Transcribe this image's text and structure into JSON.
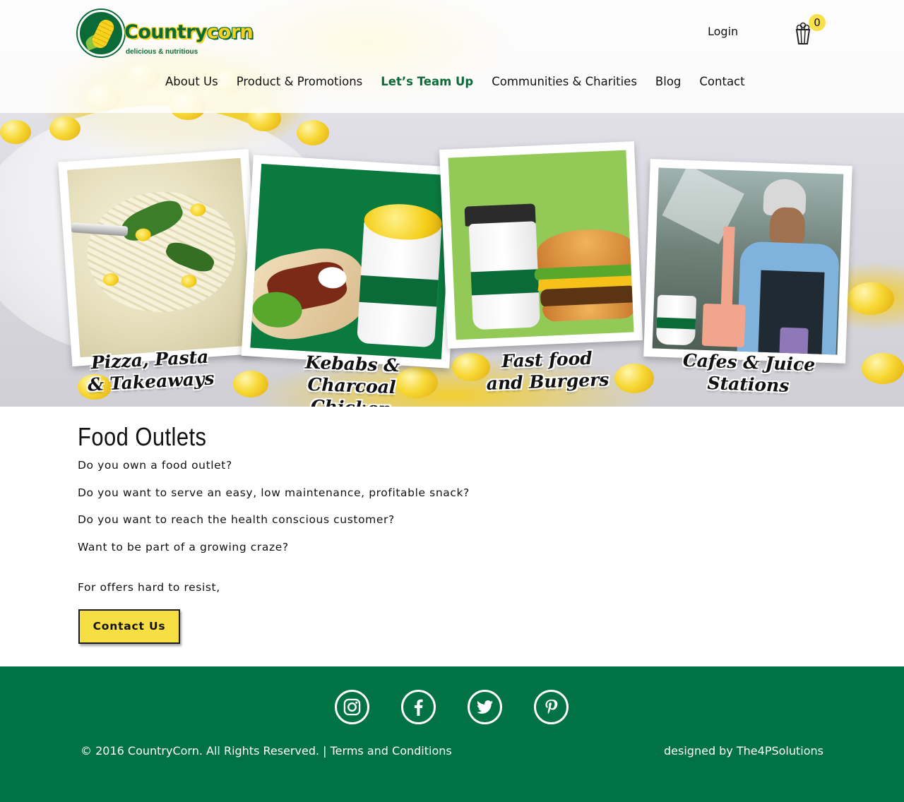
{
  "brand": {
    "name_part1": "Country",
    "name_part2": "corn",
    "tagline": "delicious & nutritious",
    "colors": {
      "green": "#0b6b38",
      "yellow": "#f5d020",
      "footer": "#007244",
      "button": "#f7de43"
    }
  },
  "header": {
    "login_label": "Login",
    "cart_icon": "popcorn-cup-icon",
    "cart_count": "0"
  },
  "nav": {
    "items": [
      {
        "label": "About Us"
      },
      {
        "label": "Product & Promotions"
      },
      {
        "label": "Let’s Team Up",
        "active": true
      },
      {
        "label": "Communities & Charities"
      },
      {
        "label": "Blog"
      },
      {
        "label": "Contact"
      }
    ]
  },
  "hero": {
    "cards": [
      {
        "caption_line1": "Pizza, Pasta",
        "caption_line2": "& Takeaways"
      },
      {
        "caption_line1": "Kebabs &",
        "caption_line2": "Charcoal Chicken"
      },
      {
        "caption_line1": "Fast food",
        "caption_line2": "and Burgers"
      },
      {
        "caption_line1": "Cafes & Juice",
        "caption_line2": "Stations"
      }
    ]
  },
  "content": {
    "title": "Food Outlets",
    "paragraphs": [
      "Do you own a food outlet?",
      "Do you want to serve an easy, low maintenance, profitable snack?",
      "Do you want to reach the health conscious customer?",
      "Want to be part of a growing craze?",
      "For offers hard to resist,"
    ],
    "button_label": "Contact Us"
  },
  "footer": {
    "social": [
      "instagram-icon",
      "facebook-icon",
      "twitter-icon",
      "pinterest-icon"
    ],
    "copyright": "© 2016 CountryCorn. All Rights Reserved. |",
    "terms_label": "Terms and Conditions",
    "designed_by": "designed by The4PSolutions"
  }
}
